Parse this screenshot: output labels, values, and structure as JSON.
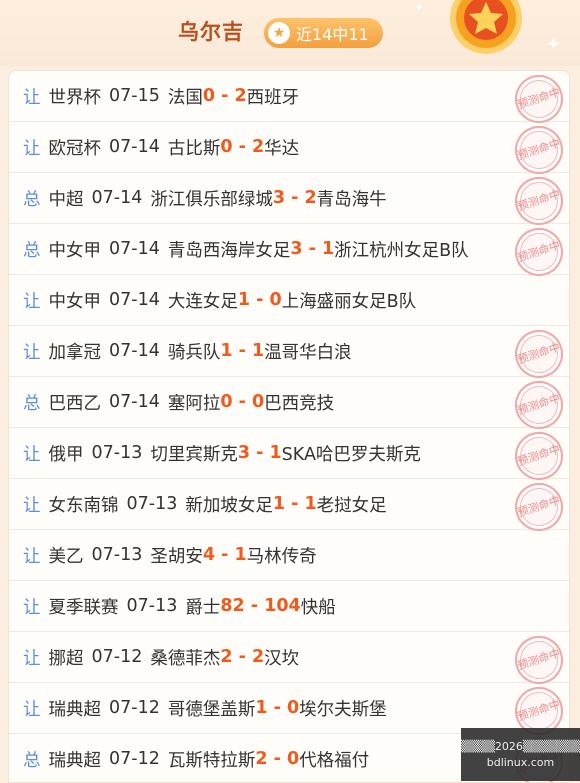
{
  "header": {
    "name": "乌尔吉",
    "badge": "近14中11"
  },
  "stamp_text": "预测命中",
  "rows": [
    {
      "type": "让",
      "league": "世界杯",
      "date": "07-15",
      "home": "法国",
      "score": "0 - 2",
      "away": "西班牙",
      "hit": true
    },
    {
      "type": "让",
      "league": "欧冠杯",
      "date": "07-14",
      "home": "古比斯",
      "score": "0 - 2",
      "away": "华达",
      "hit": true
    },
    {
      "type": "总",
      "league": "中超",
      "date": "07-14",
      "home": "浙江俱乐部绿城",
      "score": "3 - 2",
      "away": "青岛海牛",
      "hit": true
    },
    {
      "type": "总",
      "league": "中女甲",
      "date": "07-14",
      "home": "青岛西海岸女足",
      "score": "3 - 1",
      "away": "浙江杭州女足B队",
      "hit": true
    },
    {
      "type": "让",
      "league": "中女甲",
      "date": "07-14",
      "home": "大连女足",
      "score": "1 - 0",
      "away": "上海盛丽女足B队",
      "hit": false
    },
    {
      "type": "让",
      "league": "加拿冠",
      "date": "07-14",
      "home": "骑兵队",
      "score": "1 - 1",
      "away": "温哥华白浪",
      "hit": true
    },
    {
      "type": "总",
      "league": "巴西乙",
      "date": "07-14",
      "home": "塞阿拉",
      "score": "0 - 0",
      "away": "巴西竞技",
      "hit": true
    },
    {
      "type": "让",
      "league": "俄甲",
      "date": "07-13",
      "home": "切里宾斯克",
      "score": "3 - 1",
      "away": "SKA哈巴罗夫斯克",
      "hit": true
    },
    {
      "type": "让",
      "league": "女东南锦",
      "date": "07-13",
      "home": "新加坡女足",
      "score": "1 - 1",
      "away": "老挝女足",
      "hit": true
    },
    {
      "type": "让",
      "league": "美乙",
      "date": "07-13",
      "home": "圣胡安",
      "score": "4 - 1",
      "away": "马林传奇",
      "hit": false
    },
    {
      "type": "让",
      "league": "夏季联赛",
      "date": "07-13",
      "home": "爵士",
      "score": "82 - 104",
      "away": "快船",
      "hit": false
    },
    {
      "type": "让",
      "league": "挪超",
      "date": "07-12",
      "home": "桑德菲杰",
      "score": "2 - 2",
      "away": "汉坎",
      "hit": true
    },
    {
      "type": "让",
      "league": "瑞典超",
      "date": "07-12",
      "home": "哥德堡盖斯",
      "score": "1 - 0",
      "away": "埃尔夫斯堡",
      "hit": true
    },
    {
      "type": "总",
      "league": "瑞典超",
      "date": "07-12",
      "home": "瓦斯特拉斯",
      "score": "2 - 0",
      "away": "代格福付",
      "hit": true
    }
  ],
  "watermark": {
    "line1": "▒▒▒▒2026▒▒▒▒▒▒▒",
    "line2": "bdlinux.com"
  }
}
